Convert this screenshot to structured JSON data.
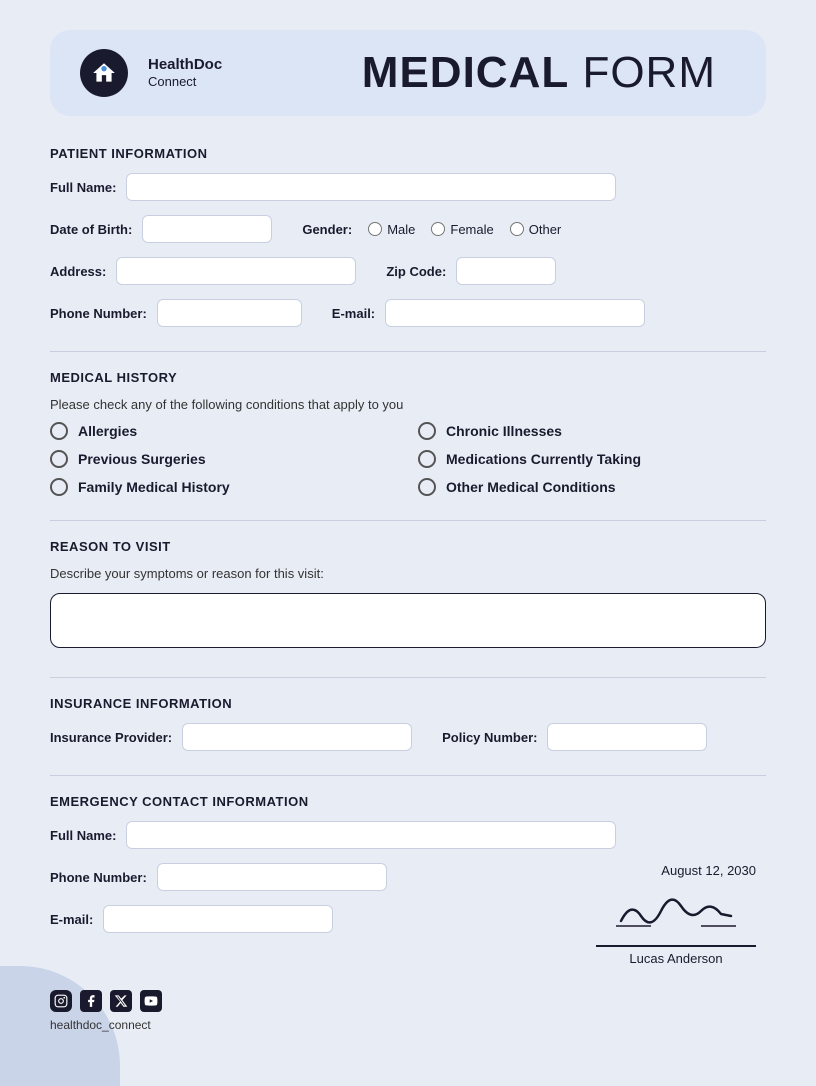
{
  "header": {
    "brand_name": "HealthDoc",
    "brand_sub": "Connect",
    "title_bold": "MEDICAL",
    "title_light": " FORM"
  },
  "patient_info": {
    "section_title": "PATIENT INFORMATION",
    "full_name_label": "Full Name:",
    "dob_label": "Date of Birth:",
    "gender_label": "Gender:",
    "gender_options": [
      "Male",
      "Female",
      "Other"
    ],
    "address_label": "Address:",
    "zip_label": "Zip Code:",
    "phone_label": "Phone Number:",
    "email_label": "E-mail:"
  },
  "medical_history": {
    "section_title": "MEDICAL HISTORY",
    "description": "Please check any of the following conditions that apply to you",
    "conditions": [
      "Allergies",
      "Chronic Illnesses",
      "Previous Surgeries",
      "Medications Currently Taking",
      "Family Medical History",
      "Other Medical Conditions"
    ]
  },
  "reason_to_visit": {
    "section_title": "REASON TO VISIT",
    "description": "Describe your symptoms or reason for this visit:"
  },
  "insurance": {
    "section_title": "INSURANCE INFORMATION",
    "provider_label": "Insurance Provider:",
    "policy_label": "Policy Number:"
  },
  "emergency": {
    "section_title": "EMERGENCY CONTACT INFORMATION",
    "full_name_label": "Full Name:",
    "phone_label": "Phone Number:",
    "email_label": "E-mail:"
  },
  "signature": {
    "date": "August 12, 2030",
    "name": "Lucas Anderson"
  },
  "footer": {
    "handle": "healthdoc_connect"
  }
}
